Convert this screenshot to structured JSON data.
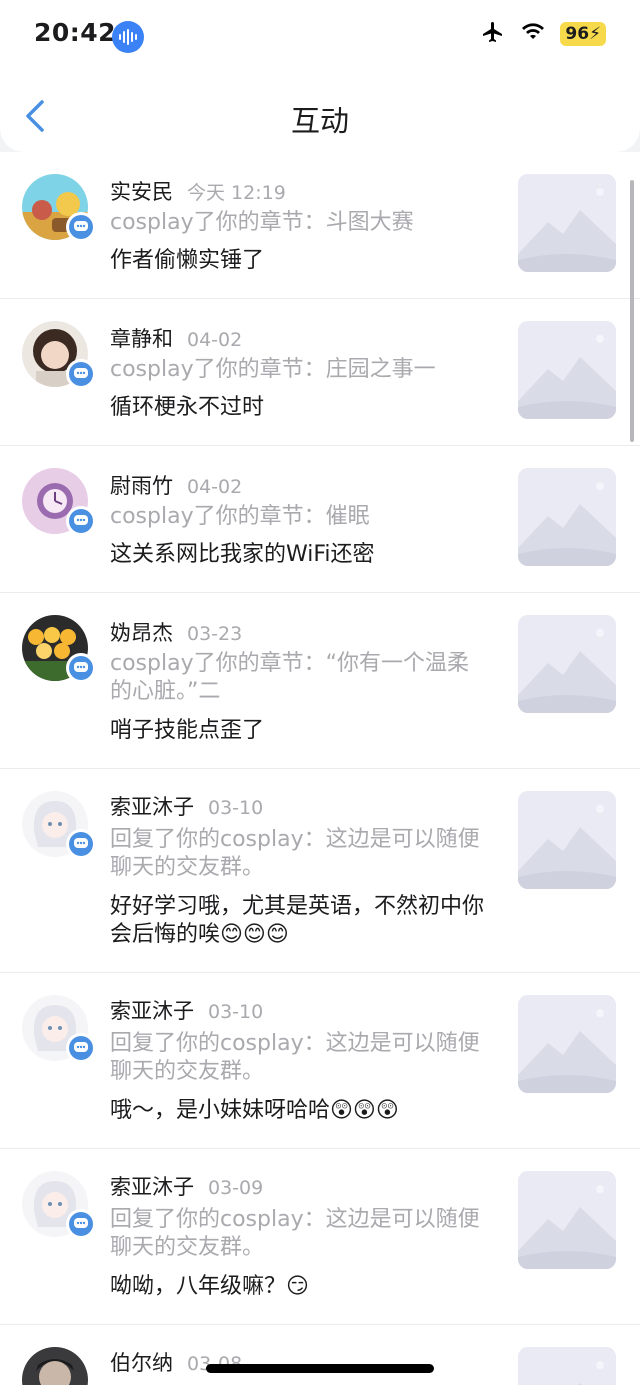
{
  "status_bar": {
    "time": "20:42",
    "battery": "96",
    "icons": [
      "sound-wave-icon",
      "airplane-icon",
      "wifi-icon",
      "battery-icon"
    ]
  },
  "nav": {
    "title": "互动",
    "back_icon": "chevron-left-icon"
  },
  "items": [
    {
      "name": "实安民",
      "date": "今天 12:19",
      "action": "cosplay了你的章节：斗图大赛",
      "comment": "作者偷懒实锤了"
    },
    {
      "name": "章静和",
      "date": "04-02",
      "action": "cosplay了你的章节：庄园之事一",
      "comment": "循环梗永不过时"
    },
    {
      "name": "尉雨竹",
      "date": "04-02",
      "action": "cosplay了你的章节：催眠",
      "comment": "这关系网比我家的WiFi还密"
    },
    {
      "name": "妫昂杰",
      "date": "03-23",
      "action": "cosplay了你的章节：“你有一个温柔的心脏。”二",
      "comment": "哨子技能点歪了"
    },
    {
      "name": "索亚沐子",
      "date": "03-10",
      "action": "回复了你的cosplay：这边是可以随便聊天的交友群。",
      "comment": "好好学习哦，尤其是英语，不然初中你会后悔的唉😊😊😊"
    },
    {
      "name": "索亚沐子",
      "date": "03-10",
      "action": "回复了你的cosplay：这边是可以随便聊天的交友群。",
      "comment": "哦～，是小妹妹呀哈哈😲😲😲"
    },
    {
      "name": "索亚沐子",
      "date": "03-09",
      "action": "回复了你的cosplay：这边是可以随便聊天的交友群。",
      "comment": "呦呦，八年级嘛？😏"
    },
    {
      "name": "伯尔纳",
      "date": "03-08",
      "action": "",
      "comment": ""
    }
  ],
  "colors": {
    "accent": "#4a90e2",
    "muted_text": "#a9a9ae",
    "battery_bg": "#f7d94c",
    "thumb_bg": "#e9eaf3"
  }
}
